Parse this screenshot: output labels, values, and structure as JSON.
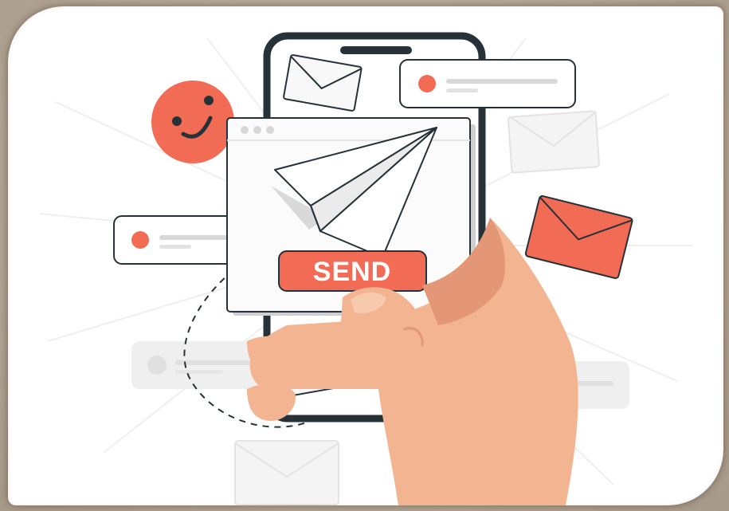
{
  "illustration": {
    "send_button_label": "SEND"
  },
  "colors": {
    "accent": "#f26b55",
    "phone_frame": "#263238",
    "skin": "#f2b491",
    "skin_shadow": "#e49777",
    "card_outline": "#263238",
    "faded": "#ededed"
  },
  "icons": [
    "smiley-face-icon",
    "envelope-icon",
    "paper-plane-icon",
    "notification-dot-icon"
  ]
}
